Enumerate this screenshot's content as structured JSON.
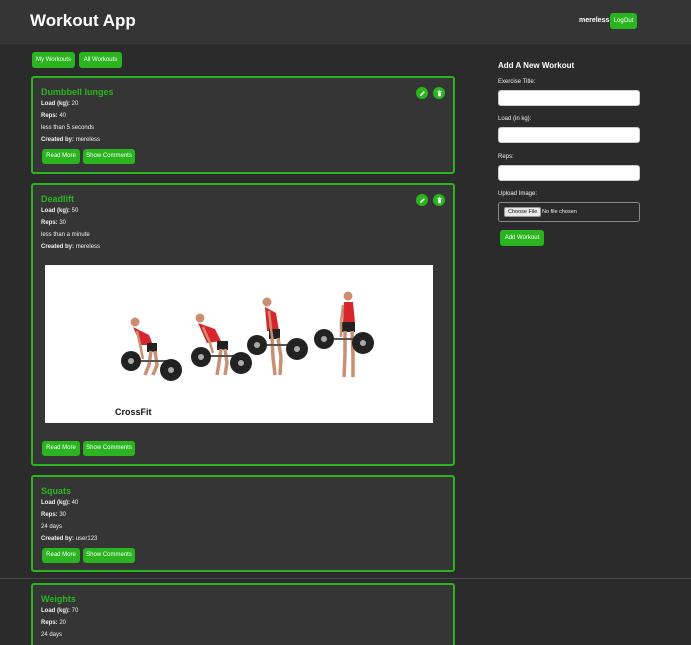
{
  "header": {
    "app_title": "Workout App",
    "username": "mereless",
    "logout_label": "LogOut"
  },
  "filters": {
    "my_workouts_label": "My Workouts",
    "all_workouts_label": "All Workouts"
  },
  "labels": {
    "load": "Load (kg):",
    "reps": "Reps:",
    "created_by": "Created by:",
    "read_more": "Read More",
    "show_comments": "Show Comments"
  },
  "workouts": [
    {
      "title": "Dumbbell lunges",
      "load": "20",
      "reps": "40",
      "time": "less than 5 seconds",
      "created_by": "mereless"
    },
    {
      "title": "Deadlift",
      "load": "50",
      "reps": "30",
      "time": "less than a minute",
      "created_by": "mereless",
      "image_brand": "CrossFit"
    },
    {
      "title": "Squats",
      "load": "40",
      "reps": "30",
      "time": "24 days",
      "created_by": "user123"
    },
    {
      "title": "Weights",
      "load": "70",
      "reps": "20",
      "time": "24 days"
    }
  ],
  "form": {
    "title": "Add A New Workout",
    "exercise_title_label": "Exercise Title:",
    "load_label": "Load (in kg):",
    "reps_label": "Reps:",
    "upload_label": "Upload Image:",
    "choose_file_label": "Choose File",
    "file_status": "No file chosen",
    "submit_label": "Add Workout"
  },
  "colors": {
    "accent": "#2ab520",
    "background": "#2b2b2b",
    "card": "#353535",
    "header": "#353535"
  },
  "icons": {
    "edit": "pencil-icon",
    "delete": "trash-icon"
  }
}
